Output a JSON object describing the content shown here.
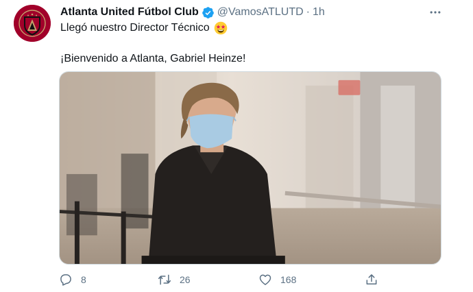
{
  "tweet": {
    "author_name": "Atlanta United Fútbol Club",
    "handle": "@VamosATLUTD",
    "separator": "·",
    "time": "1h",
    "line1": "Llegó nuestro Director Técnico",
    "line2": "¡Bienvenido a Atlanta, Gabriel Heinze!",
    "emoji_icon": "star-struck-emoji",
    "verified_icon": "verified-badge-icon",
    "more_icon": "more-options-icon",
    "media_description": "photo-man-wearing-mask-airport"
  },
  "actions": {
    "reply_count": "8",
    "retweet_count": "26",
    "like_count": "168"
  },
  "colors": {
    "brand_red": "#a1002a",
    "verified_blue": "#1da1f2",
    "muted_text": "#5b7083"
  }
}
